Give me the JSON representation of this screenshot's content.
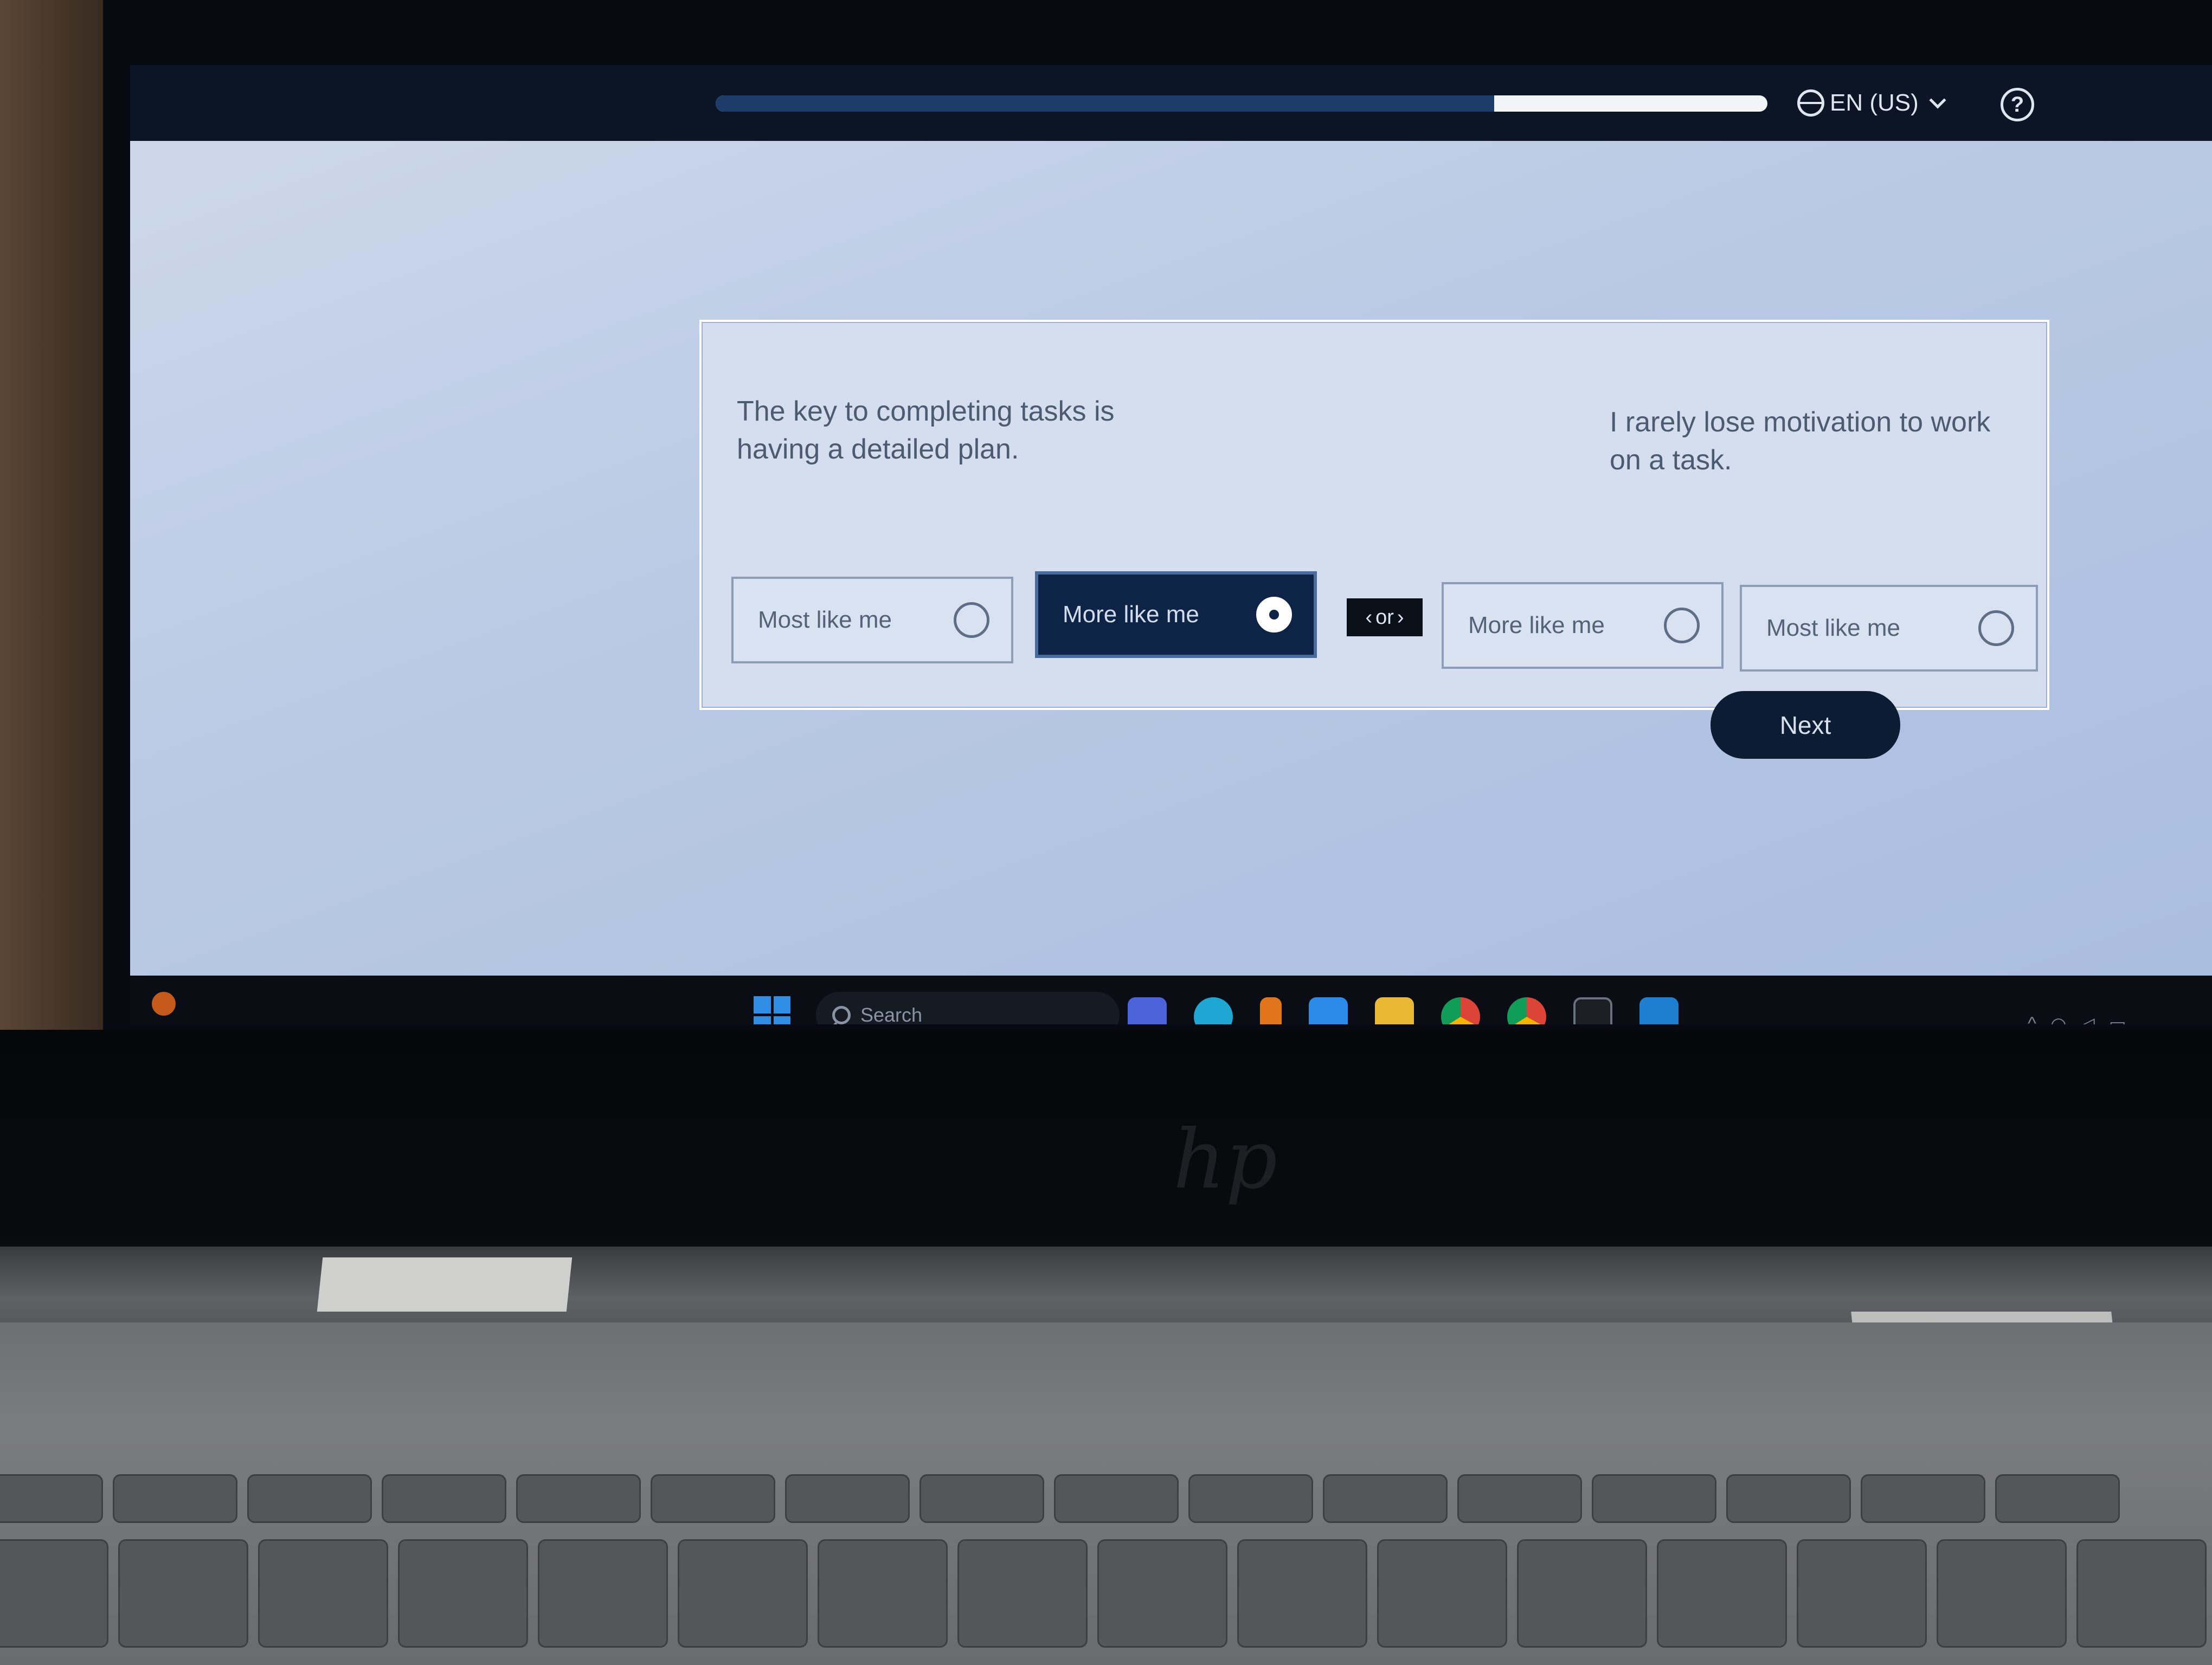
{
  "header": {
    "progress_fraction": 0.74,
    "language_label": "EN (US)",
    "help_label": "?"
  },
  "question": {
    "left_statement": "The key to completing tasks is having a detailed plan.",
    "right_statement": "I rarely lose motivation to work on a task.",
    "options": [
      {
        "label": "Most like me",
        "selected": false
      },
      {
        "label": "More like me",
        "selected": true
      },
      {
        "label": "More like me",
        "selected": false
      },
      {
        "label": "Most like me",
        "selected": false
      }
    ],
    "or_label": "or"
  },
  "next_button": {
    "label": "Next"
  },
  "taskbar": {
    "search_placeholder": "Search",
    "apps": [
      "teams-icon",
      "edge-icon",
      "sublime-icon",
      "mail-icon",
      "file-explorer-icon",
      "chrome-icon",
      "chrome-icon",
      "terminal-icon",
      "vscode-icon"
    ]
  },
  "colors": {
    "selected_option_bg": "#0d2446",
    "next_button_bg": "#0c1c33",
    "progress_fill": "#1c3c6a"
  }
}
